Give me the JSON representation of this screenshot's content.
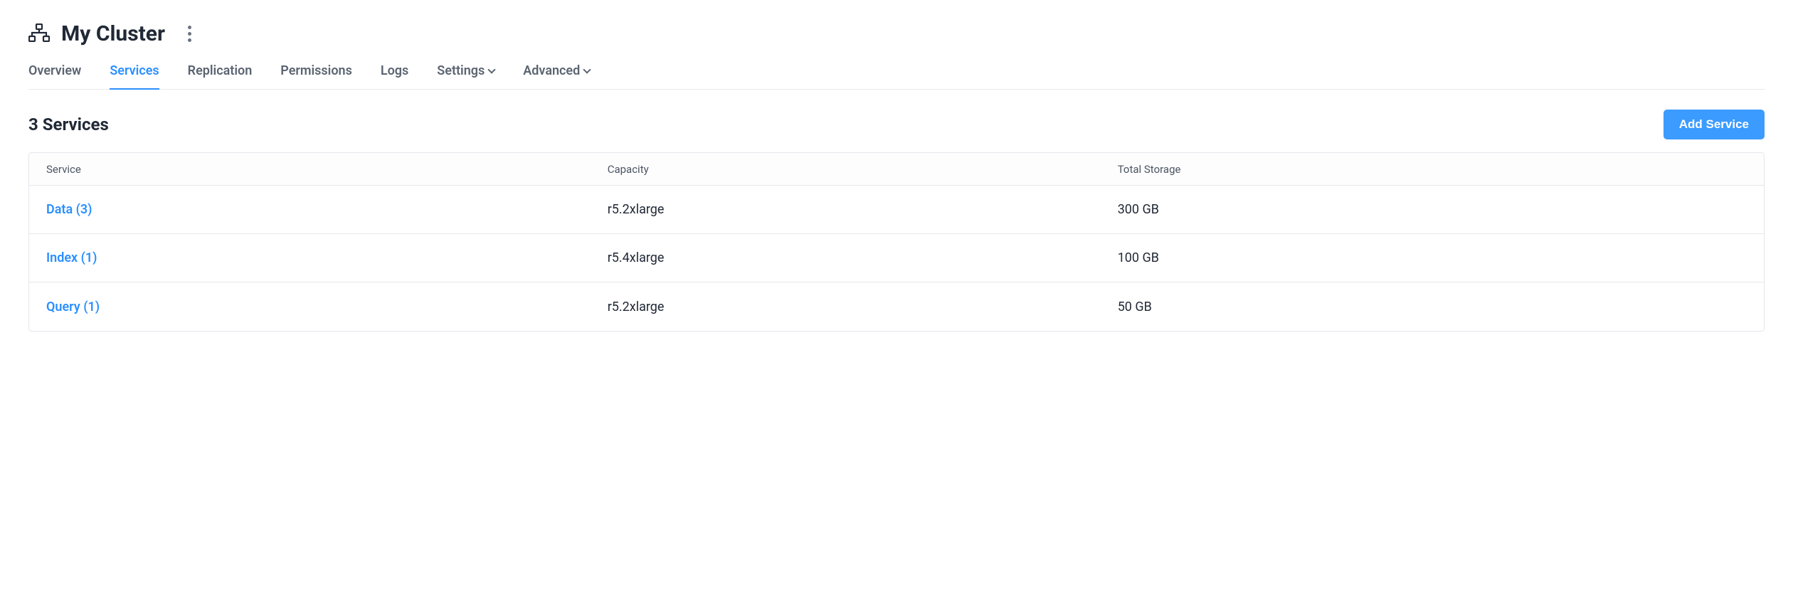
{
  "header": {
    "title": "My Cluster"
  },
  "tabs": [
    {
      "label": "Overview",
      "has_dropdown": false,
      "active": false
    },
    {
      "label": "Services",
      "has_dropdown": false,
      "active": true
    },
    {
      "label": "Replication",
      "has_dropdown": false,
      "active": false
    },
    {
      "label": "Permissions",
      "has_dropdown": false,
      "active": false
    },
    {
      "label": "Logs",
      "has_dropdown": false,
      "active": false
    },
    {
      "label": "Settings",
      "has_dropdown": true,
      "active": false
    },
    {
      "label": "Advanced",
      "has_dropdown": true,
      "active": false
    }
  ],
  "section": {
    "title": "3 Services",
    "add_button": "Add Service"
  },
  "table": {
    "columns": [
      "Service",
      "Capacity",
      "Total Storage"
    ],
    "rows": [
      {
        "service": "Data (3)",
        "capacity": "r5.2xlarge",
        "storage": "300 GB"
      },
      {
        "service": "Index (1)",
        "capacity": "r5.4xlarge",
        "storage": "100 GB"
      },
      {
        "service": "Query (1)",
        "capacity": "r5.2xlarge",
        "storage": "50 GB"
      }
    ]
  }
}
